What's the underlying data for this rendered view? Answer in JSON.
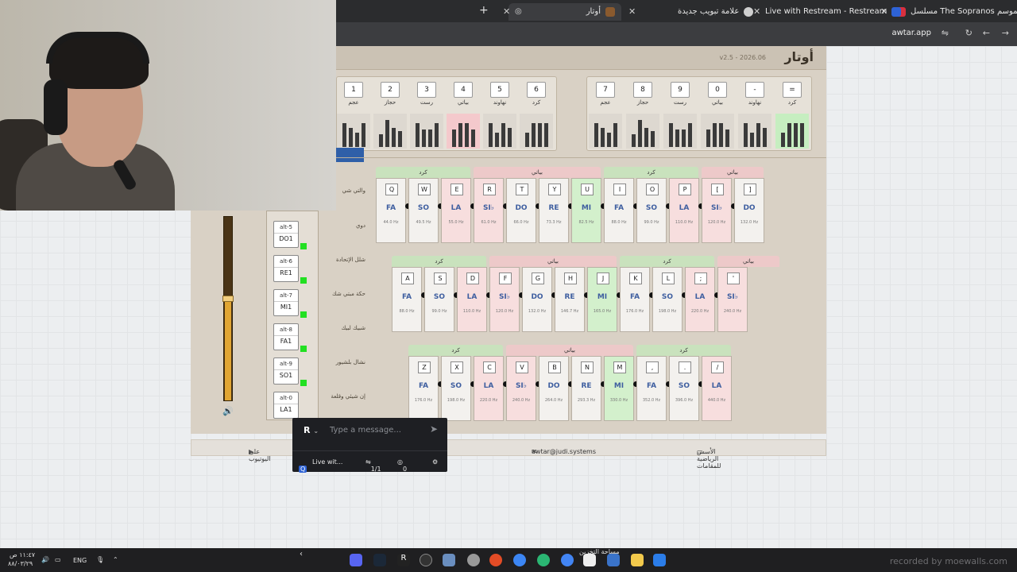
{
  "browser": {
    "tabs": [
      {
        "label": "مسلسل The Sopranos الموسم",
        "color": "#d9303e"
      },
      {
        "label": "Live with Restream - Restream",
        "color": "#2e63d6"
      },
      {
        "label": "علامة تبويب جديدة",
        "color": "#cfcfcf"
      },
      {
        "label": "أوتار",
        "color": "#8a5a2e"
      }
    ],
    "url": "awtar.app"
  },
  "app": {
    "title": "أوتار",
    "version": "v2.5 - 2026.06",
    "presets": [
      {
        "key": "1",
        "name": "عجم"
      },
      {
        "key": "2",
        "name": "حجاز"
      },
      {
        "key": "3",
        "name": "رست"
      },
      {
        "key": "4",
        "name": "بياتي"
      },
      {
        "key": "5",
        "name": "نهاوند"
      },
      {
        "key": "6",
        "name": "كرد"
      },
      {
        "key": "7",
        "name": "عجم"
      },
      {
        "key": "8",
        "name": "حجاز"
      },
      {
        "key": "9",
        "name": "رست"
      },
      {
        "key": "0",
        "name": "بياتي"
      },
      {
        "key": "-",
        "name": "نهاوند"
      },
      {
        "key": "=",
        "name": "كرد"
      }
    ],
    "row_labels": [
      "والتي شي",
      "دوي",
      "شلل الإتحادة",
      "حكة مبتي شك",
      "شبيك لبيك",
      "نشال بلشيور",
      "إن شيئي وقلعة"
    ],
    "rows": [
      {
        "maqams": [
          "كرد",
          "بياتي",
          "كرد",
          "بياتي"
        ],
        "keys": [
          {
            "k": "Q",
            "n": "FA",
            "hz": "44.0 Hz"
          },
          {
            "k": "W",
            "n": "SO",
            "hz": "49.5 Hz"
          },
          {
            "k": "E",
            "n": "LA",
            "hz": "55.0 Hz"
          },
          {
            "k": "R",
            "n": "SI♭",
            "hz": "61.0 Hz"
          },
          {
            "k": "T",
            "n": "DO",
            "hz": "66.0 Hz"
          },
          {
            "k": "Y",
            "n": "RE",
            "hz": "73.3 Hz"
          },
          {
            "k": "U",
            "n": "MI",
            "hz": "82.5 Hz"
          },
          {
            "k": "I",
            "n": "FA",
            "hz": "88.0 Hz"
          },
          {
            "k": "O",
            "n": "SO",
            "hz": "99.0 Hz"
          },
          {
            "k": "P",
            "n": "LA",
            "hz": "110.0 Hz"
          },
          {
            "k": "[",
            "n": "SI♭",
            "hz": "120.0 Hz"
          },
          {
            "k": "]",
            "n": "DO",
            "hz": "132.0 Hz"
          }
        ]
      },
      {
        "maqams": [
          "كرد",
          "بياتي",
          "كرد",
          "بياتي"
        ],
        "keys": [
          {
            "k": "A",
            "n": "FA",
            "hz": "88.0 Hz"
          },
          {
            "k": "S",
            "n": "SO",
            "hz": "99.0 Hz"
          },
          {
            "k": "D",
            "n": "LA",
            "hz": "110.0 Hz"
          },
          {
            "k": "F",
            "n": "SI♭",
            "hz": "120.0 Hz"
          },
          {
            "k": "G",
            "n": "DO",
            "hz": "132.0 Hz"
          },
          {
            "k": "H",
            "n": "RE",
            "hz": "146.7 Hz"
          },
          {
            "k": "J",
            "n": "MI",
            "hz": "165.0 Hz"
          },
          {
            "k": "K",
            "n": "FA",
            "hz": "176.0 Hz"
          },
          {
            "k": "L",
            "n": "SO",
            "hz": "198.0 Hz"
          },
          {
            "k": ";",
            "n": "LA",
            "hz": "220.0 Hz"
          },
          {
            "k": "'",
            "n": "SI♭",
            "hz": "240.0 Hz"
          }
        ]
      },
      {
        "maqams": [
          "كرد",
          "بياتي",
          "كرد"
        ],
        "keys": [
          {
            "k": "Z",
            "n": "FA",
            "hz": "176.0 Hz"
          },
          {
            "k": "X",
            "n": "SO",
            "hz": "198.0 Hz"
          },
          {
            "k": "C",
            "n": "LA",
            "hz": "220.0 Hz"
          },
          {
            "k": "V",
            "n": "SI♭",
            "hz": "240.0 Hz"
          },
          {
            "k": "B",
            "n": "DO",
            "hz": "264.0 Hz"
          },
          {
            "k": "N",
            "n": "RE",
            "hz": "293.3 Hz"
          },
          {
            "k": "M",
            "n": "MI",
            "hz": "330.0 Hz"
          },
          {
            "k": ",",
            "n": "FA",
            "hz": "352.0 Hz"
          },
          {
            "k": ".",
            "n": "SO",
            "hz": "396.0 Hz"
          },
          {
            "k": "/",
            "n": "LA",
            "hz": "440.0 Hz"
          }
        ]
      }
    ],
    "alt_keys": [
      {
        "top": "alt-5",
        "bottom": "DO1"
      },
      {
        "top": "alt-6",
        "bottom": "RE1"
      },
      {
        "top": "alt-7",
        "bottom": "MI1"
      },
      {
        "top": "alt-8",
        "bottom": "FA1"
      },
      {
        "top": "alt-9",
        "bottom": "SO1"
      },
      {
        "top": "alt-0",
        "bottom": "LA1"
      }
    ],
    "footer": {
      "youtube": "على اليوتيوب",
      "email": "awtar@judi.systems",
      "docs": "الأسس الرياضية للمقامات"
    }
  },
  "chat": {
    "placeholder": "Type a message...",
    "channel": "Live wit...",
    "pages": "1/1",
    "viewers": "0"
  },
  "taskbar": {
    "time": "١١:٤٧ ص",
    "date": "٨٨/٠٣/٢٩",
    "lang": "ENG",
    "storage": "مساحة التخزين",
    "watermark": "recorded by moewalls.com"
  }
}
